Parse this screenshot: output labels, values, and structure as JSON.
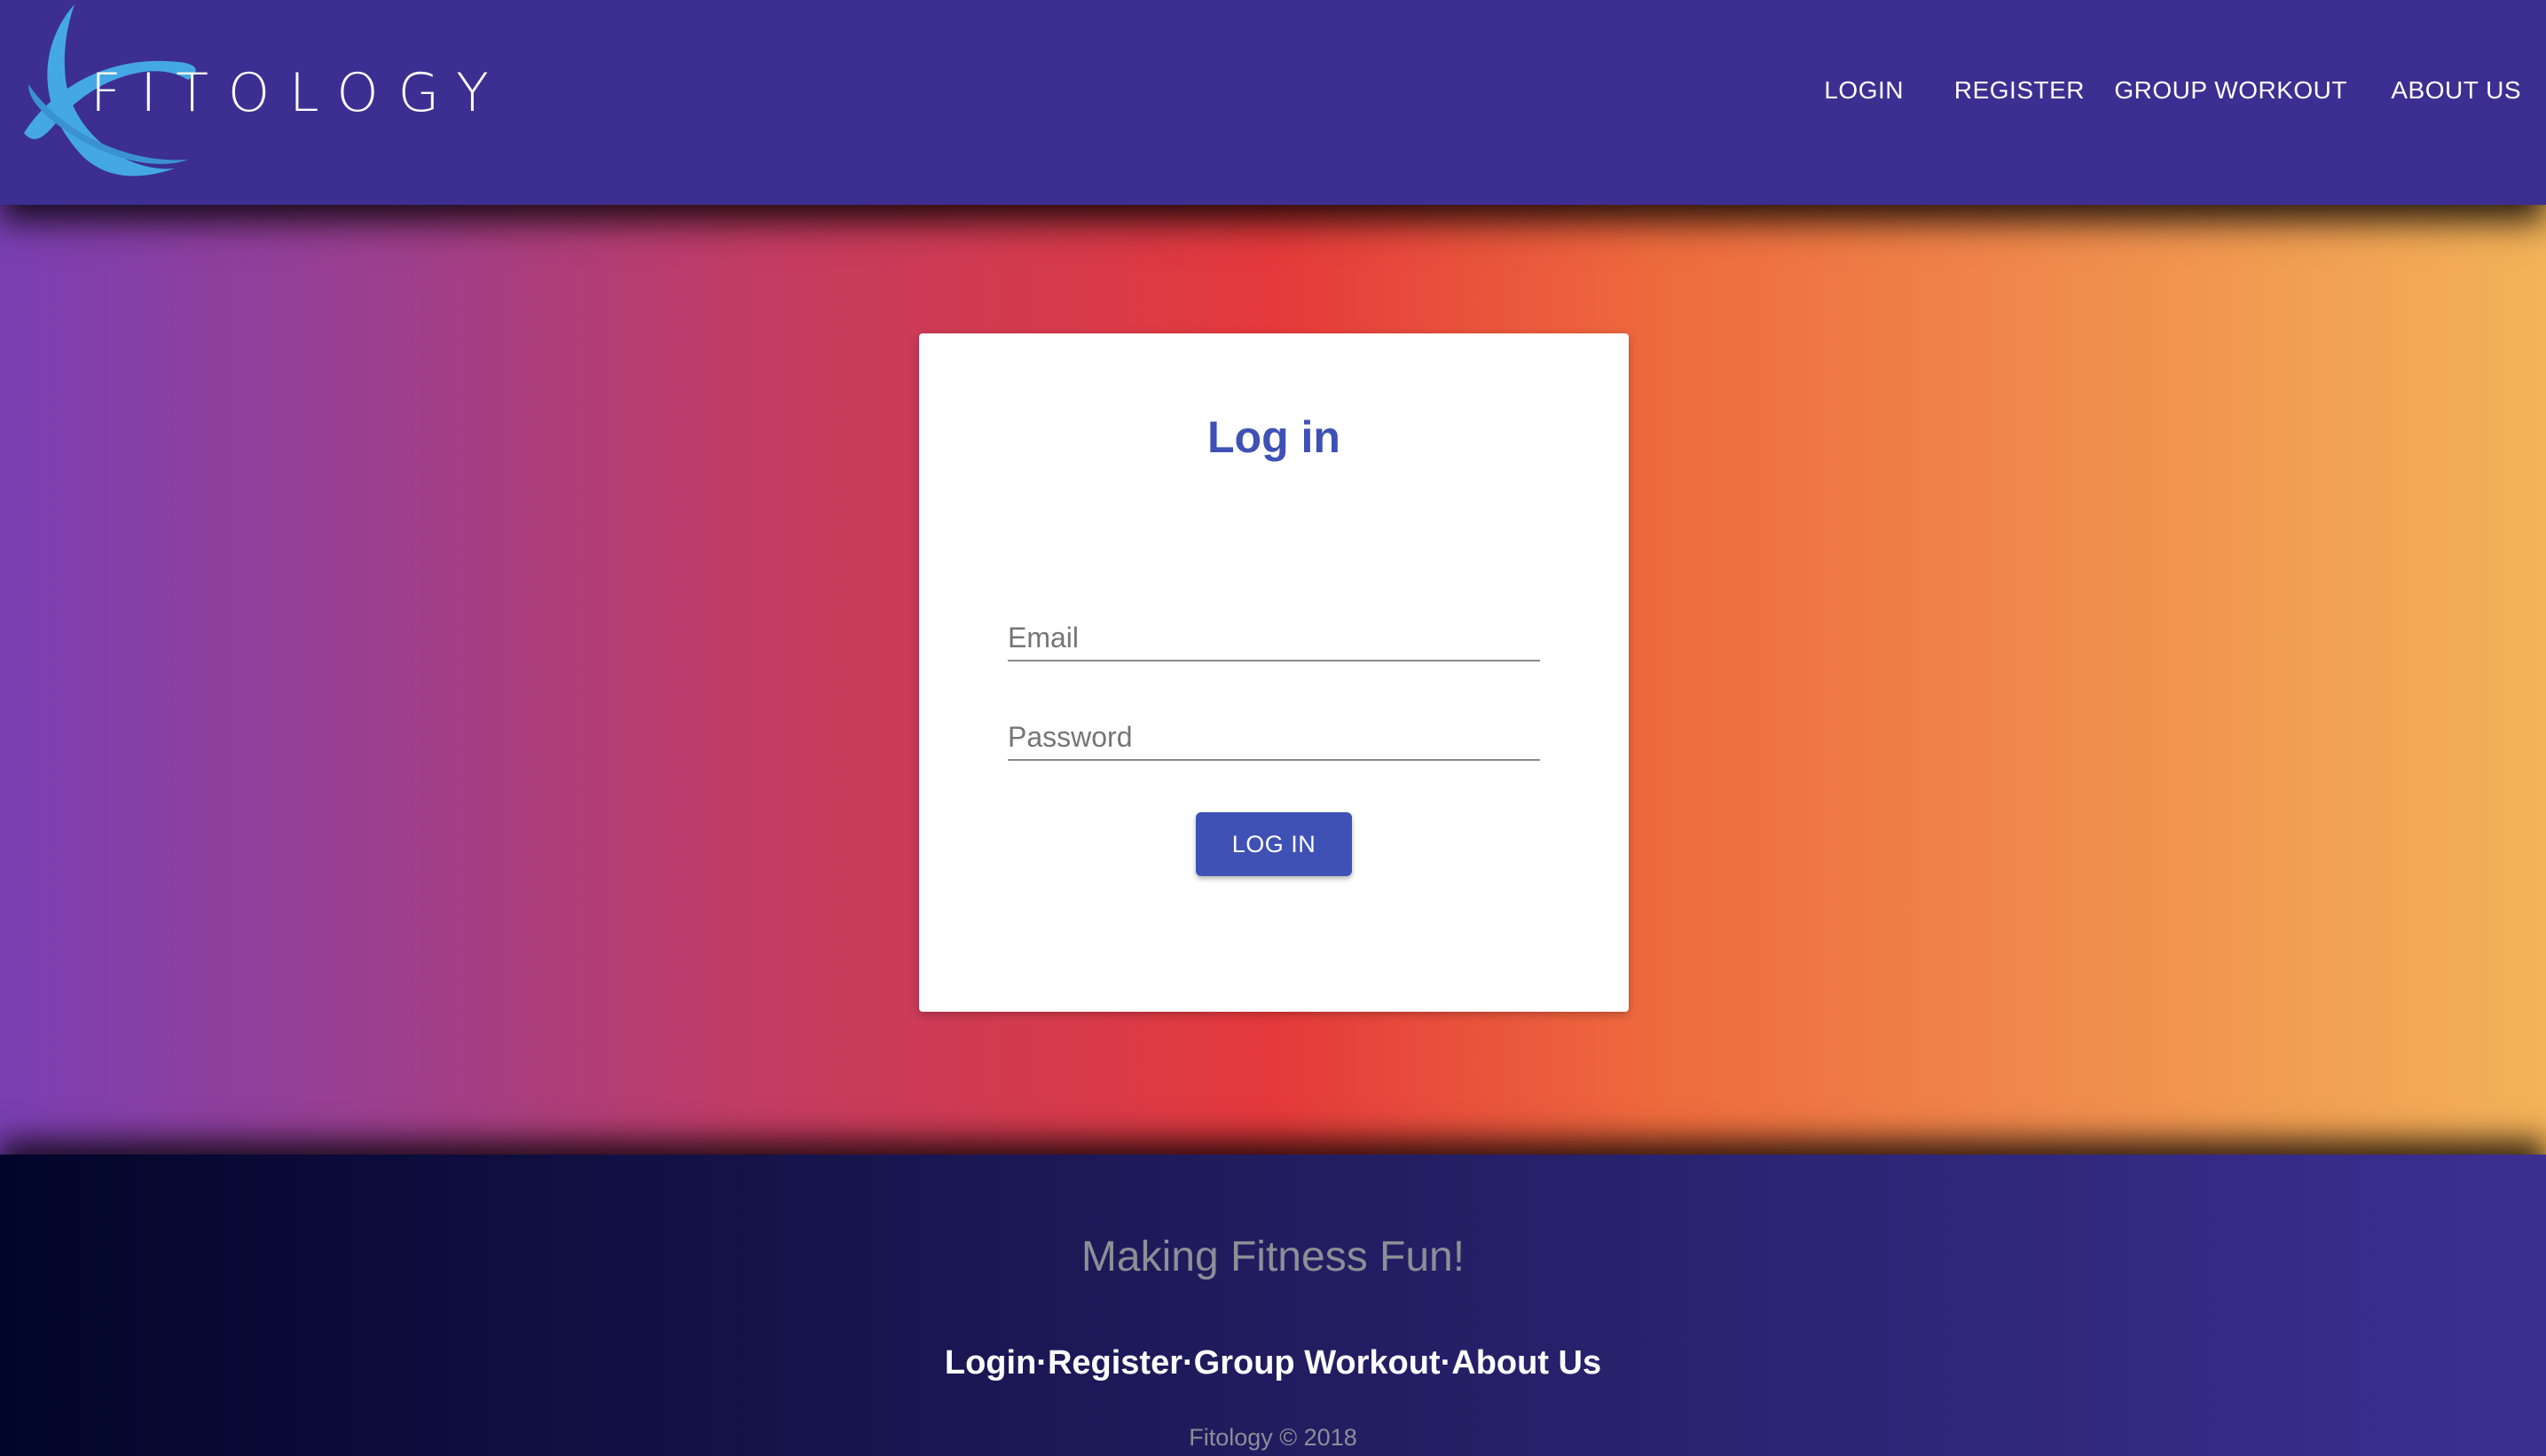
{
  "header": {
    "logo_text": "FITOLOGY",
    "nav": [
      {
        "label": "LOGIN"
      },
      {
        "label": "REGISTER"
      },
      {
        "label": "GROUP WORKOUT"
      },
      {
        "label": "ABOUT US"
      }
    ]
  },
  "login_card": {
    "title": "Log in",
    "email_placeholder": "Email",
    "email_value": "",
    "password_placeholder": "Password",
    "password_value": "",
    "button_label": "LOG IN"
  },
  "footer": {
    "tagline": "Making Fitness Fun!",
    "links": [
      {
        "label": "Login"
      },
      {
        "label": "Register"
      },
      {
        "label": "Group Workout"
      },
      {
        "label": "About Us"
      }
    ],
    "separator": "·",
    "copyright": "Fitology © 2018"
  },
  "colors": {
    "header_bg": "#3c2f91",
    "accent": "#3f51b5",
    "logo_blue": "#45a8e6"
  },
  "icons": {
    "logo": "orbit-logo-icon"
  }
}
